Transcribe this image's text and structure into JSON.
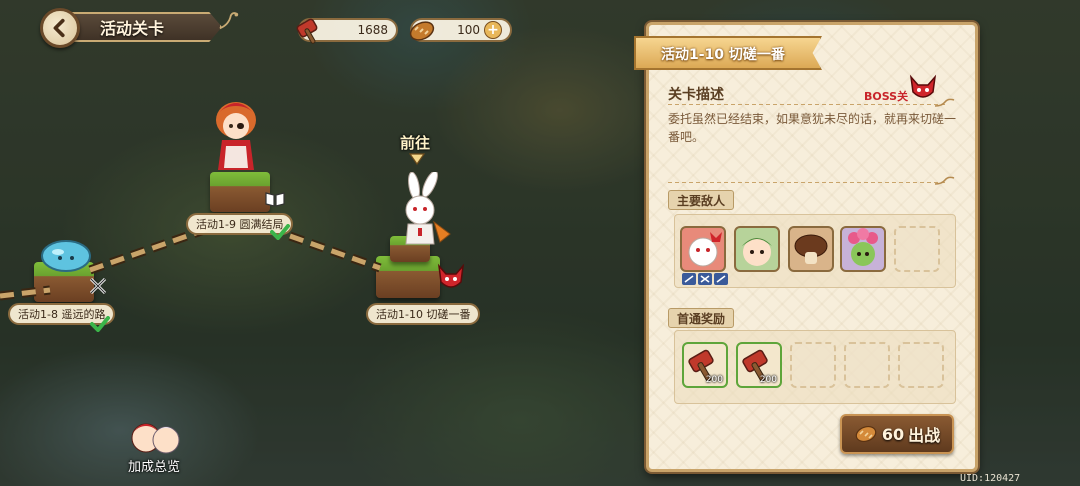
{
  "header": {
    "title": "活动关卡"
  },
  "currencies": [
    {
      "icon": "hammer-ticket-icon",
      "value": "1688"
    },
    {
      "icon": "bread-stamina-icon",
      "value": "100",
      "plus": "+"
    }
  ],
  "stages": [
    {
      "label": "活动1-8  遥远的路",
      "cleared": true
    },
    {
      "label": "活动1-9  圆满结局",
      "cleared": true
    },
    {
      "label": "活动1-10  切磋一番",
      "current": true,
      "boss": true
    }
  ],
  "goto_label": "前往",
  "bonus_label": "加成总览",
  "panel": {
    "ribbon_title": "活动1-10  切磋一番",
    "desc_title": "关卡描述",
    "boss_tag": "BOSS关",
    "description": "委托虽然已经结束，如果意犹未尽的话，就再来切磋一番吧。",
    "enemies_title": "主要敌人",
    "enemies": [
      "rabbit-boss-icon",
      "green-goblin-icon",
      "mushroom-icon",
      "flower-goblin-icon"
    ],
    "rewards_title": "首通奖励",
    "rewards": [
      {
        "icon": "hammer-ticket-icon",
        "qty": "200"
      },
      {
        "icon": "hammer-ticket-icon",
        "qty": "200"
      }
    ],
    "fight_cost": "60",
    "fight_label": "出战"
  },
  "uid": "UID:120427",
  "colors": {
    "accent": "#c9a46a",
    "boss": "#c8242a",
    "check": "#3bb54a"
  }
}
